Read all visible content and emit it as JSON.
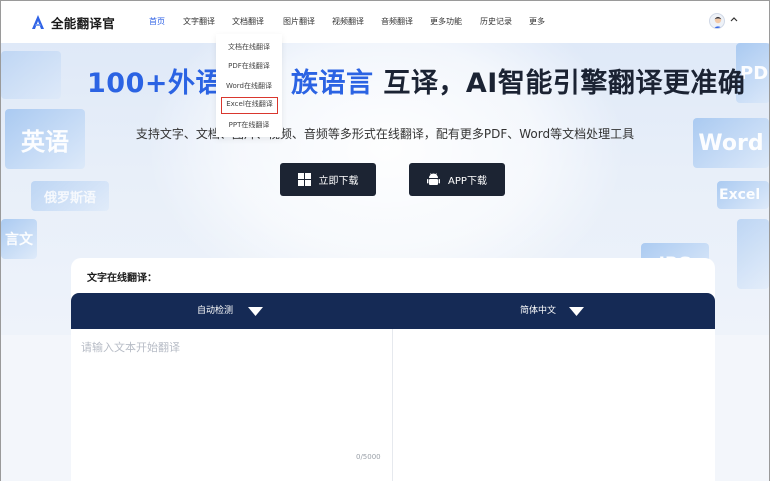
{
  "brand": {
    "name": "全能翻译官",
    "accent": "#2f62e6"
  },
  "nav": {
    "items": [
      "首页",
      "文字翻译",
      "文档翻译",
      "图片翻译",
      "视频翻译",
      "音频翻译",
      "更多功能",
      "历史记录",
      "更多"
    ],
    "active": "首页"
  },
  "dropdown": {
    "items": [
      "文档在线翻译",
      "PDF在线翻译",
      "Word在线翻译",
      "Excel在线翻译",
      "PPT在线翻译"
    ],
    "highlighted": "Excel在线翻译"
  },
  "hero": {
    "headline_blue": "100+外语",
    "headline_partial": "族语言",
    "headline_dark": " 互译，AI智能引擎翻译更准确",
    "subheadline": "支持文字、文档、图片、视频、音频等多形式在线翻译，配有更多PDF、Word等文档处理工具",
    "download_button": "立即下载",
    "app_button": "APP下载",
    "bg_tiles": [
      "英语",
      "俄罗斯语",
      "言文",
      "PD",
      "Word",
      "Excel",
      "JPG"
    ]
  },
  "translator": {
    "title": "文字在线翻译：",
    "source_lang": "自动检测",
    "target_lang": "简体中文",
    "placeholder": "请输入文本开始翻译",
    "char_count": "0/5000",
    "bar_color": "#152a55"
  }
}
